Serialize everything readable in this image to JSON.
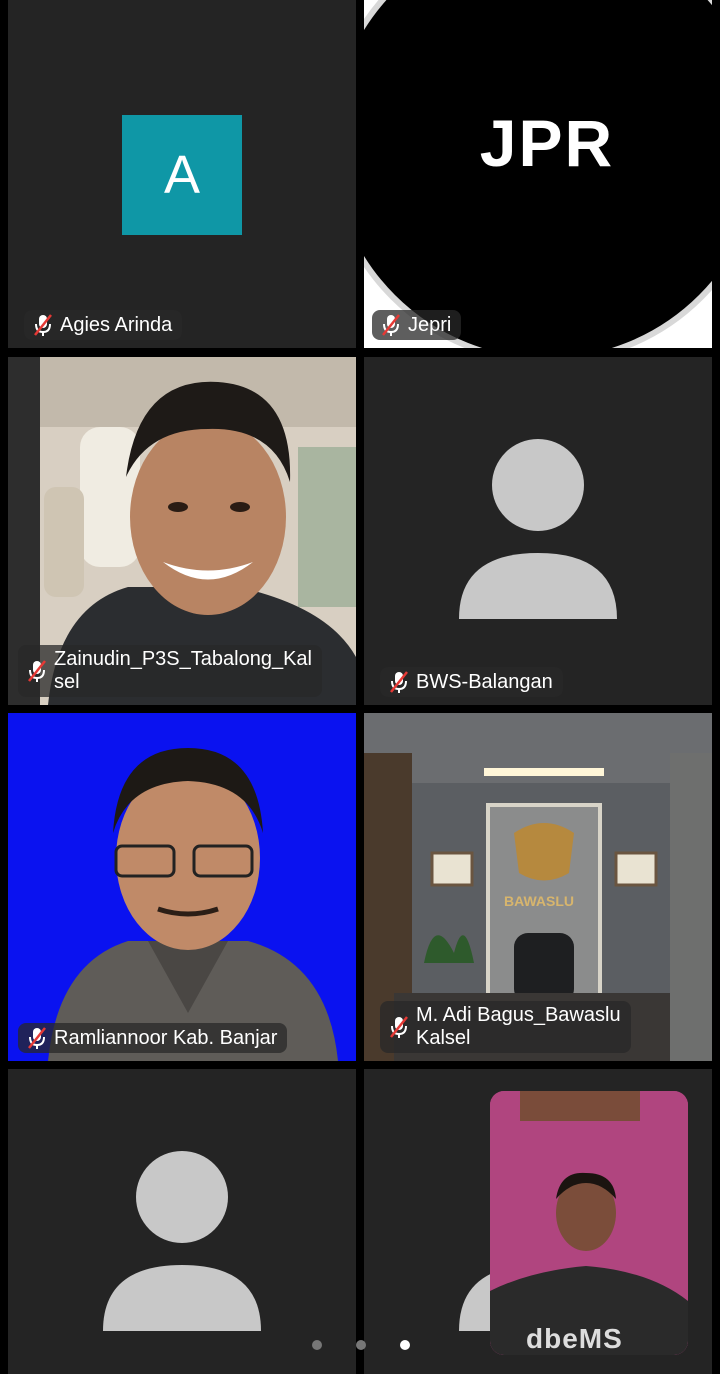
{
  "participants": [
    {
      "name": "Agies Arinda",
      "avatar_initial": "A",
      "muted": true
    },
    {
      "name": "Jepri",
      "avatar_text": "JPR",
      "muted": true
    },
    {
      "name": "Zainudin_P3S_Tabalong_Kal\nsel",
      "muted": true
    },
    {
      "name": "BWS-Balangan",
      "muted": true
    },
    {
      "name": "Ramliannoor Kab. Banjar",
      "muted": true
    },
    {
      "name": "M. Adi Bagus_Bawaslu\nKalsel",
      "muted": true,
      "background_sign": "BAWASLU"
    },
    {
      "name": "",
      "muted": false
    },
    {
      "name": "",
      "muted": false
    }
  ],
  "self_view": {
    "shirt_text": "dbeMS"
  },
  "pagination": {
    "pages": 3,
    "current": 3
  },
  "colors": {
    "tile_bg": "#242424",
    "avatar_teal": "#0f97a6",
    "placeholder_gray": "#c8c8c8",
    "blue_bg": "#0a12f0"
  }
}
